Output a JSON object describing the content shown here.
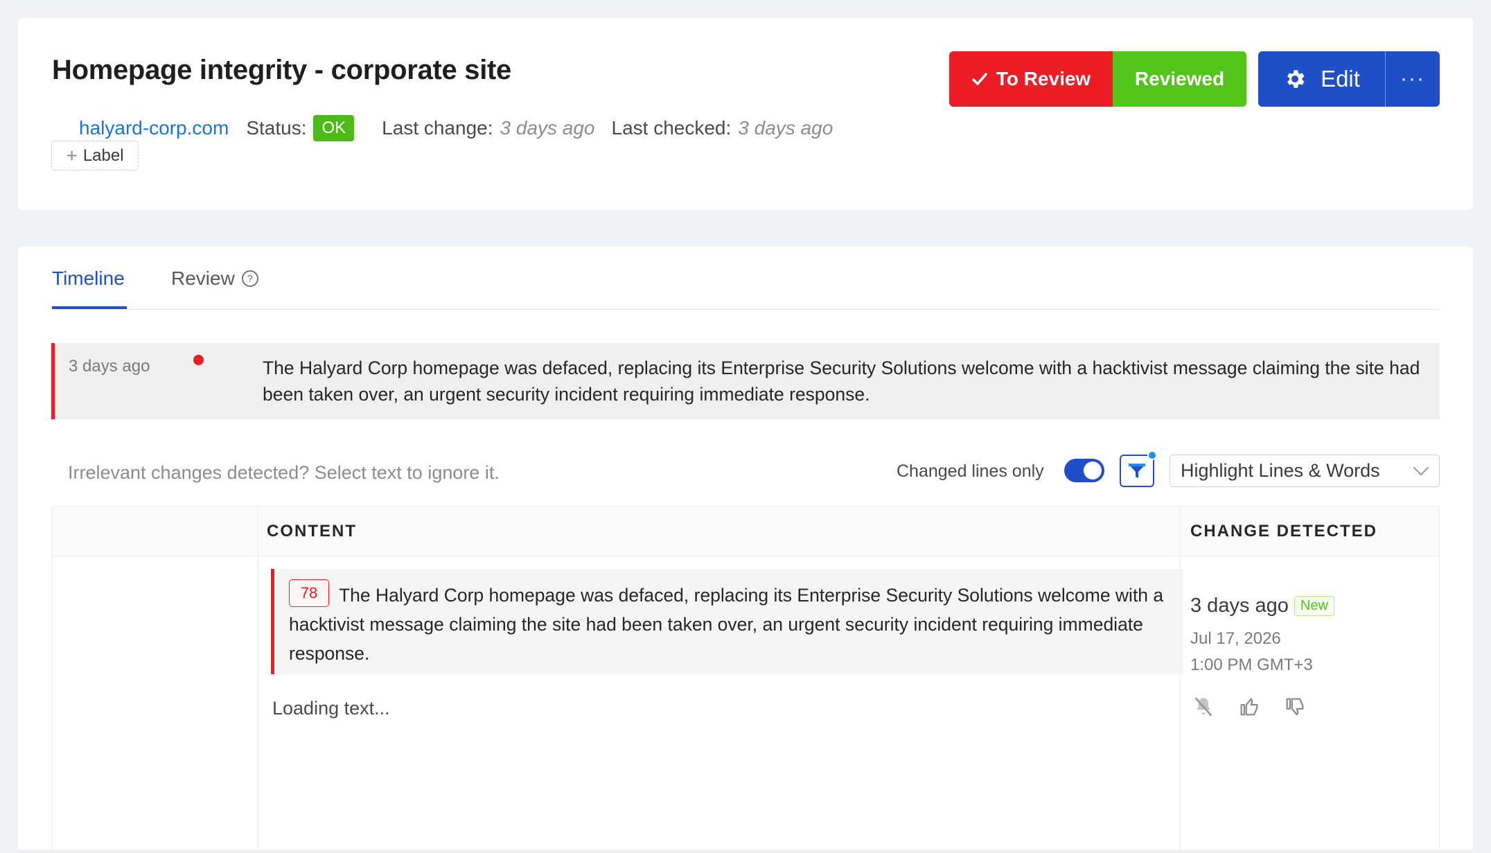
{
  "header": {
    "title": "Homepage integrity - corporate site",
    "domain_link": "halyard-corp.com",
    "status_label": "Status:",
    "status_value": "OK",
    "last_change_label": "Last change:",
    "last_change_value": "3 days ago",
    "last_checked_label": "Last checked:",
    "last_checked_value": "3 days ago",
    "add_label": "Label"
  },
  "actions": {
    "to_review": "To Review",
    "reviewed": "Reviewed",
    "edit": "Edit",
    "more": "···"
  },
  "tabs": [
    {
      "label": "Timeline",
      "active": true
    },
    {
      "label": "Review",
      "active": false
    }
  ],
  "event": {
    "time": "3 days ago",
    "text": "The Halyard Corp homepage was defaced, replacing its Enterprise Security Solutions welcome with a hacktivist message claiming the site had been taken over, an urgent security incident requiring immediate response."
  },
  "toolbar": {
    "hint": "Irrelevant changes detected? Select text to ignore it.",
    "changed_lines_label": "Changed lines only",
    "changed_lines_on": true,
    "highlight_mode": "Highlight Lines & Words"
  },
  "table": {
    "headers": [
      "",
      "CONTENT",
      "CHANGE DETECTED"
    ],
    "row": {
      "line_number": "78",
      "content": "The Halyard Corp homepage was defaced, replacing its Enterprise Security Solutions welcome with a hacktivist message claiming the site had been taken over, an urgent security incident requiring immediate response.",
      "loading": "Loading text...",
      "detected_ago": "3 days ago",
      "badge": "New",
      "date": "Jul 17, 2026",
      "time": "1:00 PM GMT+3"
    }
  },
  "colors": {
    "accent_blue": "#1f4fc7",
    "alert_red": "#ee1c25",
    "ok_green": "#52c41a"
  },
  "icons": [
    "check-icon",
    "gear-icon",
    "help-icon",
    "filter-icon",
    "chevron-down-icon",
    "bell-off-icon",
    "thumbs-up-icon",
    "thumbs-down-icon"
  ]
}
